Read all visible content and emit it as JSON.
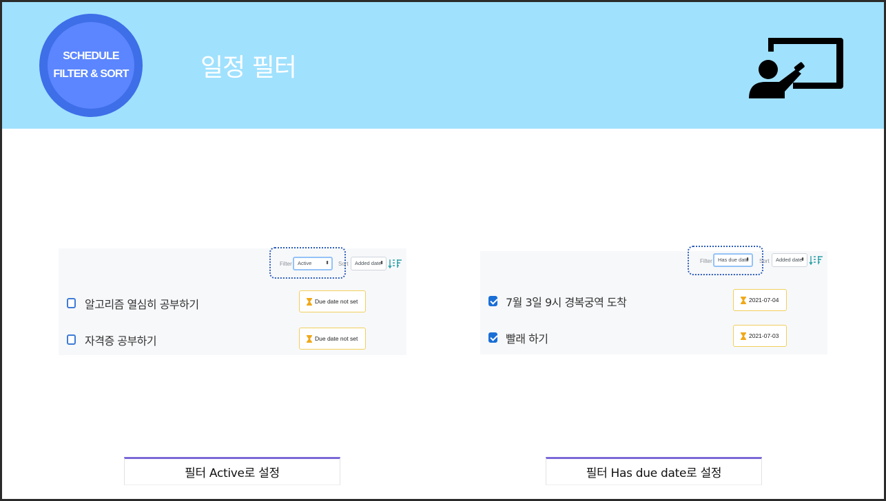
{
  "header": {
    "badge_line1": "SCHEDULE",
    "badge_line2": "FILTER & SORT",
    "title": "일정 필터",
    "icon": "teacher-presentation-icon",
    "bg_color": "#a0e1fe",
    "badge_color": "#5b86ff"
  },
  "left_panel": {
    "filter_label": "Filter",
    "filter_value": "Active",
    "sort_label": "Sort",
    "sort_value": "Added date",
    "tasks": [
      {
        "text": "알고리즘 열심히 공부하기",
        "due": "Due date not set",
        "checked": false
      },
      {
        "text": "자격증 공부하기",
        "due": "Due date not set",
        "checked": false
      }
    ],
    "caption": "필터 Active로 설정"
  },
  "right_panel": {
    "filter_label": "Filter",
    "filter_value": "Has due date",
    "sort_label": "Sort",
    "sort_value": "Added date",
    "tasks": [
      {
        "text": "7월 3일 9시 경복궁역 도착",
        "due": "2021-07-04",
        "checked": true
      },
      {
        "text": "빨래 하기",
        "due": "2021-07-03",
        "checked": true
      }
    ],
    "caption": "필터 Has due date로 설정"
  },
  "colors": {
    "accent": "#7b68d8",
    "checkbox": "#1a6fd6",
    "due_border": "#f2cf5b",
    "hourglass": "#f0a818"
  }
}
